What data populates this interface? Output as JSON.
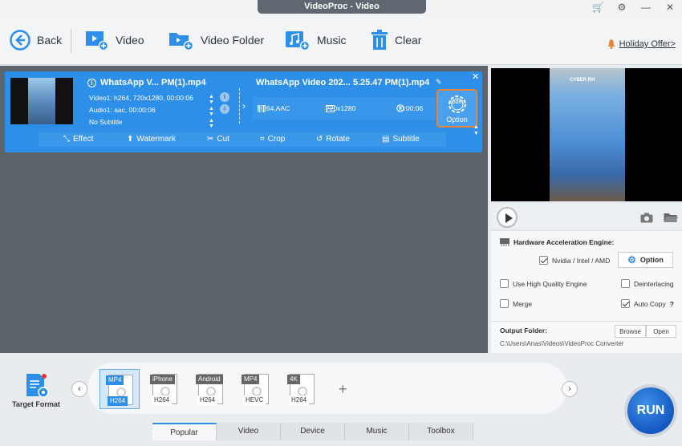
{
  "window": {
    "title": "VideoProc - Video"
  },
  "toolbar": {
    "back": "Back",
    "video": "Video",
    "video_folder": "Video Folder",
    "music": "Music",
    "clear": "Clear",
    "holiday": "Holiday Offer>"
  },
  "file": {
    "name": "WhatsApp V... PM(1).mp4",
    "video_track": "Video1: h264, 720x1280, 00:00:06",
    "audio_track": "Audio1: aac, 00:00:06",
    "subtitle": "No Subtitle",
    "output_name": "WhatsApp Video 202... 5.25.47 PM(1).mp4",
    "codec": "H264,AAC",
    "resolution": "720x1280",
    "duration": "00:00:06",
    "codec_badge": "codec",
    "codec_option": "Option"
  },
  "edit_tools": [
    "Effect",
    "Watermark",
    "Cut",
    "Crop",
    "Rotate",
    "Subtitle"
  ],
  "preview": {
    "overlay_text": "CYBER RH"
  },
  "settings": {
    "hw_title": "Hardware Acceleration Engine:",
    "hw_vendor": "Nvidia / Intel / AMD",
    "option_btn": "Option",
    "high_quality": "Use High Quality Engine",
    "deinterlacing": "Deinterlacing",
    "merge": "Merge",
    "auto_copy": "Auto Copy",
    "help": "?",
    "output_folder_label": "Output Folder:",
    "browse": "Browse",
    "open": "Open",
    "output_path": "C:\\Users\\Anas\\Videos\\VideoProc Converter"
  },
  "target_format": "Target Format",
  "formats": [
    {
      "top": "MP4",
      "bottom": "H264"
    },
    {
      "top": "iPhone",
      "bottom": "H264"
    },
    {
      "top": "Android",
      "bottom": "H264"
    },
    {
      "top": "MP4",
      "bottom": "HEVC"
    },
    {
      "top": "4K",
      "bottom": "H264"
    }
  ],
  "tabs": [
    "Popular",
    "Video",
    "Device",
    "Music",
    "Toolbox"
  ],
  "run": "RUN",
  "colors": {
    "accent": "#2d8fe8",
    "highlight": "#e8843c"
  }
}
